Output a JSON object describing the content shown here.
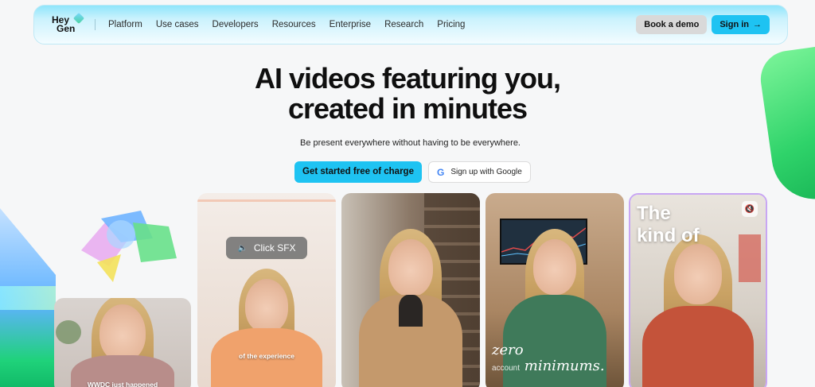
{
  "brand": {
    "logo_line1": "Hey",
    "logo_line2": "Gen"
  },
  "nav": {
    "links": [
      "Platform",
      "Use cases",
      "Developers",
      "Resources",
      "Enterprise",
      "Research",
      "Pricing"
    ],
    "book_demo": "Book a demo",
    "sign_in": "Sign in",
    "sign_in_arrow": "→"
  },
  "hero": {
    "title_line1": "AI videos featuring you,",
    "title_line2": "created in minutes",
    "subtitle": "Be present everywhere without having to be everywhere.",
    "cta_primary": "Get started free of charge",
    "cta_google": "Sign up with Google",
    "google_glyph": "G"
  },
  "cards": {
    "card1_caption": "WWDC just happened",
    "card2_chip": "Click SFX",
    "card2_chip_icon": "🔈",
    "card2_caption": "of the experience",
    "card4_line1": "zero",
    "card4_line2": "account",
    "card4_line3": "minimums.",
    "card5_line1": "The",
    "card5_line2": "kind of",
    "card5_mute_icon": "🔇"
  },
  "colors": {
    "accent": "#1ec3f2",
    "nav_gradient_top": "#8fe5fb"
  }
}
